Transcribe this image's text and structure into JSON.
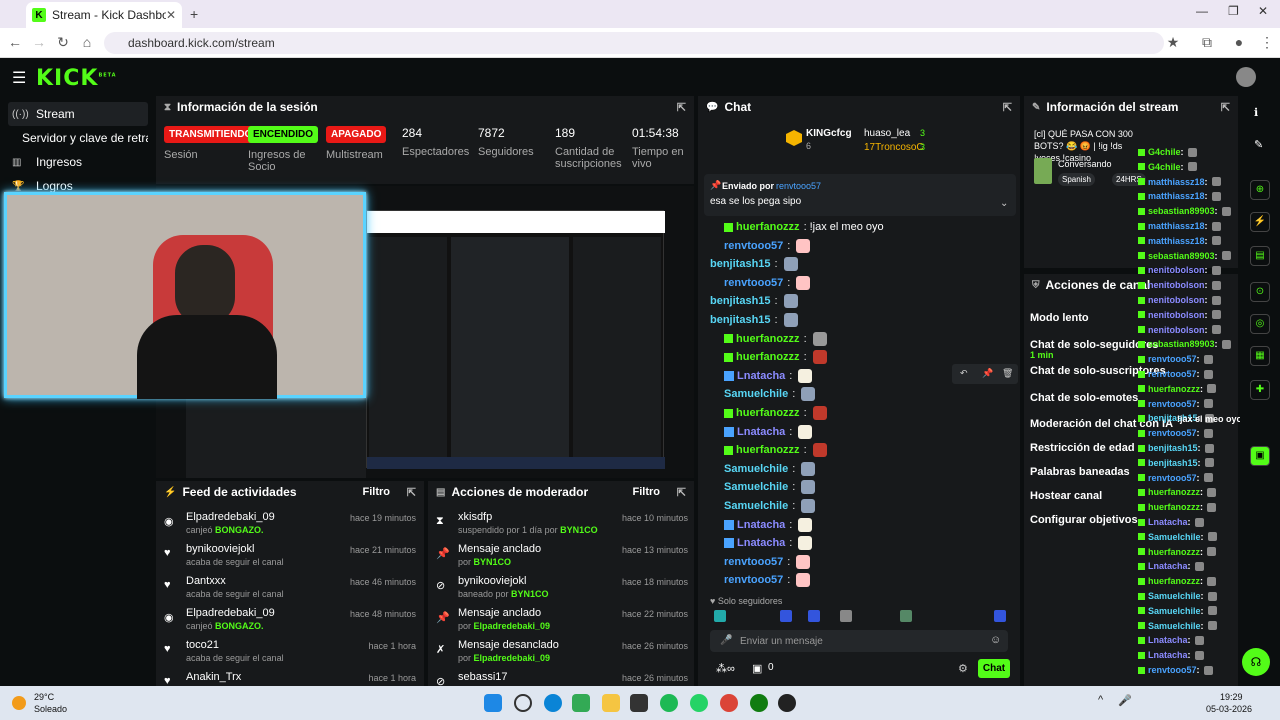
{
  "browser": {
    "tab_title": "Stream - Kick Dashboard",
    "url": "dashboard.kick.com/stream"
  },
  "header": {
    "logo": "KICK",
    "logo_sup": "BETA"
  },
  "sidebar": {
    "items": [
      {
        "label": "Stream",
        "icon": "radio-icon"
      },
      {
        "label": "Servidor y clave de retransm",
        "icon": ""
      },
      {
        "label": "Ingresos",
        "icon": "chart-icon"
      },
      {
        "label": "Logros",
        "icon": "trophy-icon"
      }
    ]
  },
  "session": {
    "title": "Información de la sesión",
    "stats": [
      {
        "badge": "TRANSMITIENDO",
        "label": "Sesión",
        "color": "#e91916"
      },
      {
        "badge": "ENCENDIDO",
        "label": "Ingresos de Socio",
        "color": "#53fc18"
      },
      {
        "badge": "APAGADO",
        "label": "Multistream",
        "color": "#e91916"
      },
      {
        "num": "284",
        "label": "Espectadores"
      },
      {
        "num": "7872",
        "label": "Seguidores"
      },
      {
        "num": "189",
        "label": "Cantidad de suscripciones"
      },
      {
        "num": "01:54:38",
        "label": "Tiempo en vivo"
      }
    ]
  },
  "feed": {
    "title": "Feed de actividades",
    "filter": "Filtro",
    "rows": [
      {
        "name": "Elpadredebaki_09",
        "sub_pre": "canjeó ",
        "sub_hl": "BONGAZO.",
        "time": "hace 19 minutos",
        "icon": "coin-icon"
      },
      {
        "name": "bynikooviejokl",
        "sub_pre": "acaba de seguir el canal",
        "sub_hl": "",
        "time": "hace 21 minutos",
        "icon": "heart-icon"
      },
      {
        "name": "Dantxxx",
        "sub_pre": "acaba de seguir el canal",
        "sub_hl": "",
        "time": "hace 46 minutos",
        "icon": "heart-icon"
      },
      {
        "name": "Elpadredebaki_09",
        "sub_pre": "canjeó ",
        "sub_hl": "BONGAZO.",
        "time": "hace 48 minutos",
        "icon": "coin-icon"
      },
      {
        "name": "toco21",
        "sub_pre": "acaba de seguir el canal",
        "sub_hl": "",
        "time": "hace 1 hora",
        "icon": "heart-icon"
      },
      {
        "name": "Anakin_Trx",
        "sub_pre": "",
        "sub_hl": "",
        "time": "hace 1 hora",
        "icon": "heart-icon"
      }
    ]
  },
  "mod": {
    "title": "Acciones de moderador",
    "filter": "Filtro",
    "rows": [
      {
        "name": "xkisdfp",
        "sub_pre": "suspendido por 1 día por ",
        "sub_hl": "BYN1CO",
        "time": "hace 10 minutos",
        "icon": "hourglass-icon"
      },
      {
        "name": "Mensaje anclado",
        "sub_pre": "por ",
        "sub_hl": "BYN1CO",
        "time": "hace 13 minutos",
        "icon": "pin-icon"
      },
      {
        "name": "bynikooviejokl",
        "sub_pre": "baneado por ",
        "sub_hl": "BYN1CO",
        "time": "hace 18 minutos",
        "icon": "ban-icon"
      },
      {
        "name": "Mensaje anclado",
        "sub_pre": "por ",
        "sub_hl": "Elpadredebaki_09",
        "time": "hace 22 minutos",
        "icon": "pin-icon"
      },
      {
        "name": "Mensaje desanclado",
        "sub_pre": "por ",
        "sub_hl": "Elpadredebaki_09",
        "time": "hace 26 minutos",
        "icon": "unpin-icon"
      },
      {
        "name": "sebassi17",
        "sub_pre": "",
        "sub_hl": "",
        "time": "hace 26 minutos",
        "icon": "ban-icon"
      }
    ]
  },
  "chat": {
    "title": "Chat",
    "top_gifters": [
      {
        "name": "KINGcfcg",
        "count": "6"
      },
      {
        "name": "huaso_lea",
        "count": "3"
      },
      {
        "name": "17TroncosoC",
        "count": "3"
      }
    ],
    "pinned_by_label": "Enviado por",
    "pinned_by_user": "renvtooo57",
    "pinned_text": "esa se los pega sipo",
    "messages": [
      {
        "user": "huerfanozzz",
        "text": "!jax el meo oyo",
        "color": "green",
        "emote": ""
      },
      {
        "user": "renvtooo57",
        "text": "",
        "color": "blue",
        "emote": "#ffc4c4"
      },
      {
        "user": "benjitash15",
        "text": "",
        "color": "cyan",
        "emote": "#8fa0b8"
      },
      {
        "user": "renvtooo57",
        "text": "",
        "color": "blue",
        "emote": "#ffc4c4"
      },
      {
        "user": "benjitash15",
        "text": "",
        "color": "cyan",
        "emote": "#8fa0b8"
      },
      {
        "user": "benjitash15",
        "text": "",
        "color": "cyan",
        "emote": "#8fa0b8"
      },
      {
        "user": "huerfanozzz",
        "text": "",
        "color": "green",
        "emote": "#999"
      },
      {
        "user": "huerfanozzz",
        "text": "",
        "color": "green",
        "emote": "#c0392b"
      },
      {
        "user": "Lnatacha",
        "text": "",
        "color": "purple",
        "emote": "#f5f0e0"
      },
      {
        "user": "Samuelchile",
        "text": "",
        "color": "cyan",
        "emote": "#8fa0b8"
      },
      {
        "user": "huerfanozzz",
        "text": "",
        "color": "green",
        "emote": "#c0392b"
      },
      {
        "user": "Lnatacha",
        "text": "",
        "color": "purple",
        "emote": "#f5f0e0"
      },
      {
        "user": "huerfanozzz",
        "text": "",
        "color": "green",
        "emote": "#c0392b"
      },
      {
        "user": "Samuelchile",
        "text": "",
        "color": "cyan",
        "emote": "#8fa0b8"
      },
      {
        "user": "Samuelchile",
        "text": "",
        "color": "cyan",
        "emote": "#8fa0b8"
      },
      {
        "user": "Samuelchile",
        "text": "",
        "color": "cyan",
        "emote": "#8fa0b8"
      },
      {
        "user": "Lnatacha",
        "text": "",
        "color": "purple",
        "emote": "#f5f0e0"
      },
      {
        "user": "Lnatacha",
        "text": "",
        "color": "purple",
        "emote": "#f5f0e0"
      },
      {
        "user": "renvtooo57",
        "text": "",
        "color": "blue",
        "emote": "#ffc4c4"
      },
      {
        "user": "renvtooo57",
        "text": "",
        "color": "blue",
        "emote": "#ffc4c4"
      }
    ],
    "followers_only": "Solo seguidores",
    "input_placeholder": "Enviar un mensaje",
    "send_label": "Chat",
    "count": "0"
  },
  "stream_info": {
    "title": "Información del stream",
    "stream_title": "[cl] QUÉ PASA CON 300 BOTS? 😂 😡 | !ig !ds !voces !casino",
    "category": "Conversando",
    "tags": [
      "Spanish",
      "24HRS"
    ]
  },
  "channel_actions": {
    "title": "Acciones de canal",
    "items": [
      {
        "label": "Modo lento",
        "sub": ""
      },
      {
        "label": "Chat de solo-seguidores",
        "sub": "1 min"
      },
      {
        "label": "Chat de solo-suscriptores",
        "sub": ""
      },
      {
        "label": "Chat de solo-emotes",
        "sub": ""
      },
      {
        "label": "Moderación del chat con IA",
        "sub": ""
      },
      {
        "label": "Restricción de edad",
        "sub": ""
      },
      {
        "label": "Palabras baneadas",
        "sub": ""
      },
      {
        "label": "Hostear canal",
        "sub": ""
      },
      {
        "label": "Configurar objetivos",
        "sub": ""
      }
    ]
  },
  "overlay_chat": [
    {
      "user": "G4chile",
      "c": "green"
    },
    {
      "user": "G4chile",
      "c": "green"
    },
    {
      "user": "matthiassz18",
      "c": "blue"
    },
    {
      "user": "matthiassz18",
      "c": "blue"
    },
    {
      "user": "sebastian89903",
      "c": "green"
    },
    {
      "user": "matthiassz18",
      "c": "blue"
    },
    {
      "user": "matthiassz18",
      "c": "blue"
    },
    {
      "user": "sebastian89903",
      "c": "green"
    },
    {
      "user": "nenitobolson",
      "c": "purple"
    },
    {
      "user": "nenitobolson",
      "c": "purple"
    },
    {
      "user": "nenitobolson",
      "c": "purple"
    },
    {
      "user": "nenitobolson",
      "c": "purple"
    },
    {
      "user": "nenitobolson",
      "c": "purple"
    },
    {
      "user": "sebastian89903",
      "c": "green"
    },
    {
      "user": "renvtooo57",
      "c": "blue"
    },
    {
      "user": "renvtooo57",
      "c": "blue"
    },
    {
      "user": "huerfanozzz",
      "c": "green"
    },
    {
      "user": "renvtooo57",
      "c": "blue"
    },
    {
      "user": "benjitash15",
      "c": "cyan"
    },
    {
      "user": "renvtooo57",
      "c": "blue"
    },
    {
      "user": "benjitash15",
      "c": "cyan"
    },
    {
      "user": "benjitash15",
      "c": "cyan"
    },
    {
      "user": "renvtooo57",
      "c": "blue"
    },
    {
      "user": "huerfanozzz",
      "c": "green"
    },
    {
      "user": "huerfanozzz",
      "c": "green"
    },
    {
      "user": "Lnatacha",
      "c": "purple"
    },
    {
      "user": "Samuelchile",
      "c": "cyan"
    },
    {
      "user": "huerfanozzz",
      "c": "green"
    },
    {
      "user": "Lnatacha",
      "c": "purple"
    },
    {
      "user": "huerfanozzz",
      "c": "green"
    },
    {
      "user": "Samuelchile",
      "c": "cyan"
    },
    {
      "user": "Samuelchile",
      "c": "cyan"
    },
    {
      "user": "Samuelchile",
      "c": "cyan"
    },
    {
      "user": "Lnatacha",
      "c": "purple"
    },
    {
      "user": "Lnatacha",
      "c": "purple"
    },
    {
      "user": "renvtooo57",
      "c": "blue"
    }
  ],
  "overlay_msg": "!jax el meo oyo",
  "taskbar": {
    "temp": "29°C",
    "weather": "Soleado",
    "time": "19:29",
    "date": "05-03-2026"
  }
}
